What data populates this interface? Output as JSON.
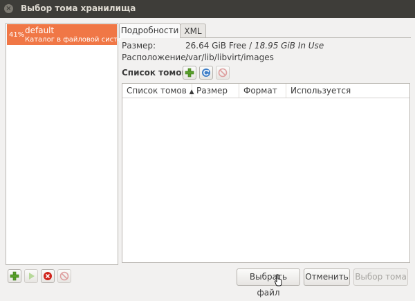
{
  "window": {
    "title": "Выбор тома хранилища",
    "close_glyph": "×"
  },
  "pools": [
    {
      "percent": "41%",
      "name": "default",
      "description": "Каталог в файловой систе..."
    }
  ],
  "tabs": [
    {
      "label": "Подробности",
      "active": true
    },
    {
      "label": "XML",
      "active": false
    }
  ],
  "details": {
    "size_label": "Размер:",
    "size_free": "26.64 GiB Free",
    "size_sep": " / ",
    "size_used": "18.95 GiB In Use",
    "location_label": "Расположение:",
    "location_value": "/var/lib/libvirt/images"
  },
  "volumes": {
    "section_label": "Список томов",
    "columns": [
      "Список томов",
      "Размер",
      "Формат",
      "Используется"
    ],
    "sort_indicator": "▲",
    "rows": []
  },
  "buttons": {
    "browse_local": "Выбрать файл",
    "cancel": "Отменить",
    "choose_volume": "Выбор тома"
  },
  "colors": {
    "accent": "#f07746",
    "titlebar": "#3e3d39"
  }
}
